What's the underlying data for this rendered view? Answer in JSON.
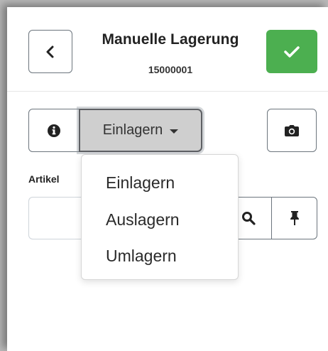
{
  "header": {
    "title": "Manuelle Lagerung",
    "subtitle": "15000001",
    "back_icon": "chevron-left-icon",
    "confirm_icon": "check-icon",
    "confirm_color": "#4caf50"
  },
  "toolbar": {
    "info_icon": "info-circle-icon",
    "dropdown_selected": "Einlagern",
    "camera_icon": "camera-icon"
  },
  "dropdown_menu": {
    "items": [
      {
        "label": "Einlagern"
      },
      {
        "label": "Auslagern"
      },
      {
        "label": "Umlagern"
      }
    ]
  },
  "artikel": {
    "label": "Artikel",
    "value": "",
    "search_icon": "search-icon",
    "pin_icon": "pin-icon"
  }
}
